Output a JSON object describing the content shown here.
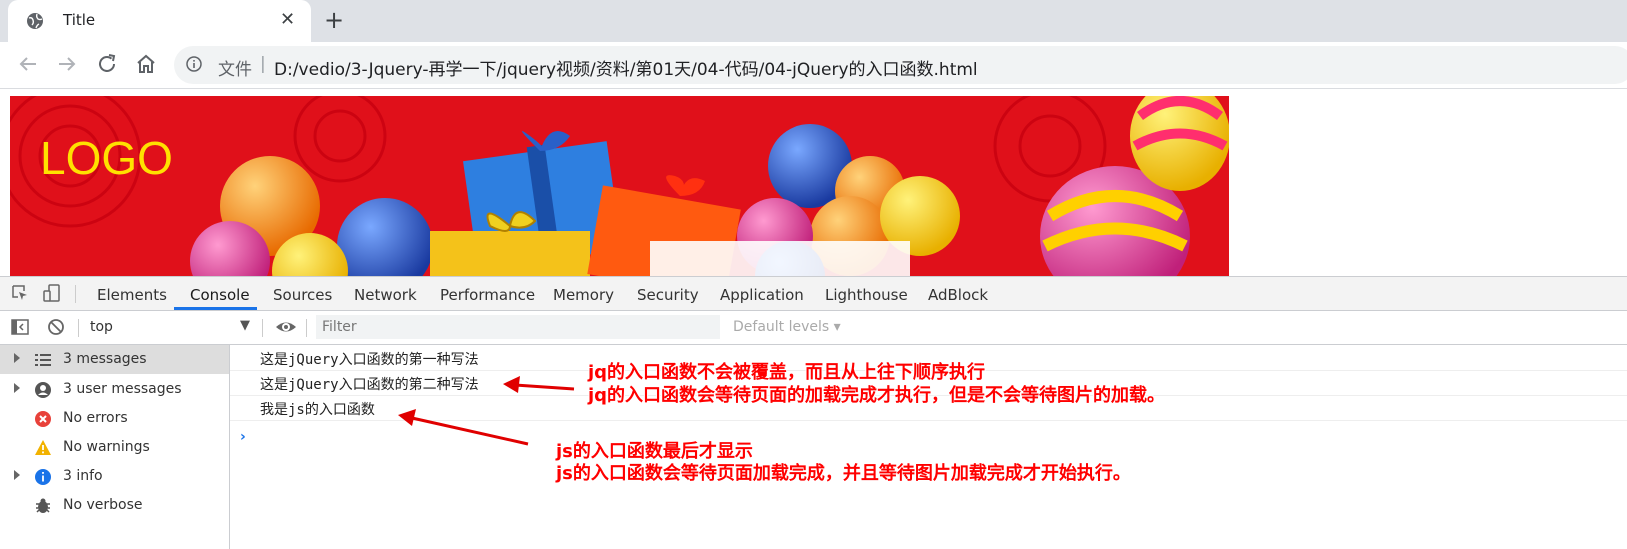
{
  "browser": {
    "tab_title": "Title",
    "close_symbol": "✕",
    "new_tab_symbol": "+",
    "site_label": "文件",
    "url_separator": "|",
    "url": "D:/vedio/3-Jquery-再学一下/jquery视频/资料/第01天/04-代码/04-jQuery的入口函数.html",
    "icons": [
      "globe-icon",
      "back-arrow-icon",
      "forward-arrow-icon",
      "reload-icon",
      "home-icon",
      "info-icon"
    ]
  },
  "banner": {
    "logo_text": "LOGO",
    "background_color": "#e0101a",
    "logo_color": "#ffe100"
  },
  "devtools": {
    "tabs": [
      "Elements",
      "Console",
      "Sources",
      "Network",
      "Performance",
      "Memory",
      "Security",
      "Application",
      "Lighthouse",
      "AdBlock"
    ],
    "active_tab": "Console",
    "context": "top",
    "filter_placeholder": "Filter",
    "levels_label": "Default levels ▾",
    "sidebar": [
      {
        "label": "3 messages",
        "icon": "list-icon"
      },
      {
        "label": "3 user messages",
        "icon": "user-icon"
      },
      {
        "label": "No errors",
        "icon": "error-icon"
      },
      {
        "label": "No warnings",
        "icon": "warning-icon"
      },
      {
        "label": "3 info",
        "icon": "info-icon"
      },
      {
        "label": "No verbose",
        "icon": "bug-icon"
      }
    ],
    "console_logs": [
      "这是jQuery入口函数的第一种写法",
      "这是jQuery入口函数的第二种写法",
      "我是js的入口函数"
    ],
    "prompt_symbol": "›"
  },
  "annotations": {
    "jq_line1": "jq的入口函数不会被覆盖，而且从上往下顺序执行",
    "jq_line2": "jq的入口函数会等待页面的加载完成才执行，但是不会等待图片的加载。",
    "js_line1": "js的入口函数最后才显示",
    "js_line2": "js的入口函数会等待页面加载完成，并且等待图片加载完成才开始执行。",
    "color": "#ff0000"
  }
}
